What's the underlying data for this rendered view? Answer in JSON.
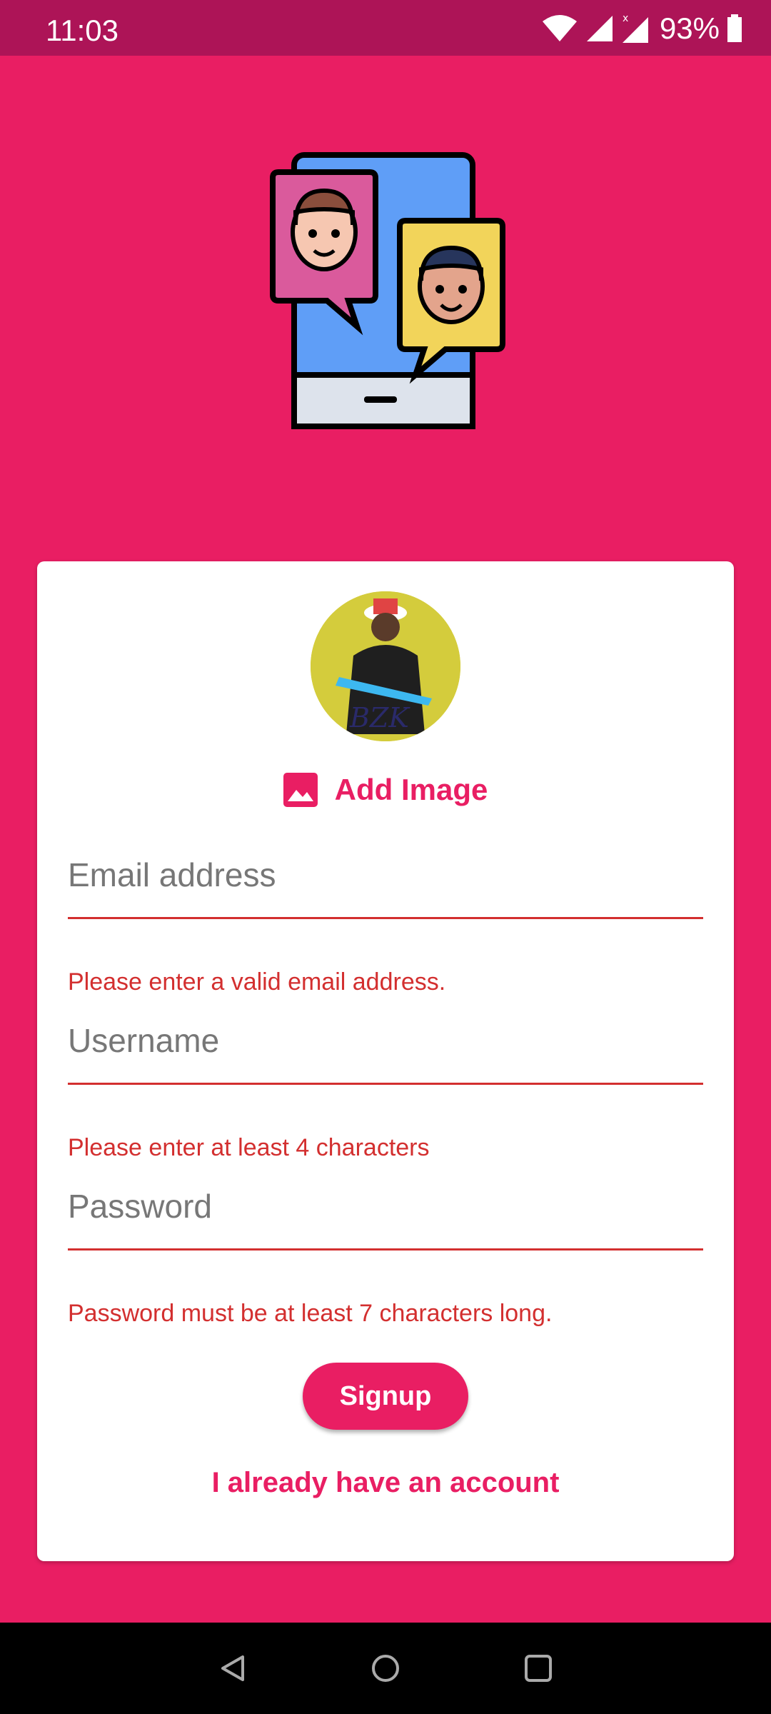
{
  "status_bar": {
    "time": "11:03",
    "battery": "93%"
  },
  "form": {
    "add_image_label": "Add Image",
    "email_placeholder": "Email address",
    "email_error": "Please enter a valid email address.",
    "username_placeholder": "Username",
    "username_error": "Please enter at least 4 characters",
    "password_placeholder": "Password",
    "password_error": "Password must be at least 7 characters long.",
    "signup_label": "Signup",
    "login_link": "I already have an account"
  },
  "colors": {
    "background": "#E91E63",
    "status_bar": "#AD1457",
    "error": "#D32F2F"
  },
  "icons": [
    "wifi-icon",
    "signal-icon",
    "battery-icon",
    "image-icon",
    "back-icon",
    "home-icon",
    "recents-icon"
  ]
}
